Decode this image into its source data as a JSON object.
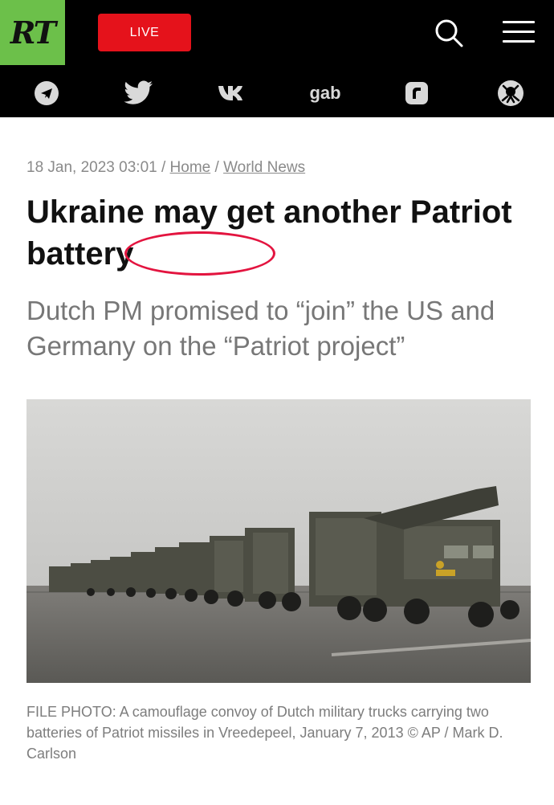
{
  "header": {
    "logo_text": "RT",
    "live_label": "LIVE",
    "social_icons": [
      "telegram-icon",
      "twitter-icon",
      "vk-icon",
      "gab-icon",
      "rumble-icon",
      "odysee-icon"
    ],
    "gab_label": "gab",
    "colors": {
      "logo": "#6cc04a",
      "live": "#e5121b",
      "bar": "#000000"
    }
  },
  "article": {
    "date": "18 Jan, 2023 03:01",
    "separator": "/",
    "breadcrumb": [
      "Home",
      "World News"
    ],
    "title": "Ukraine may get another Patriot battery",
    "subtitle": "Dutch PM promised to “join” the US and Germany on the “Patriot project”",
    "caption": "FILE PHOTO: A camouflage convoy of Dutch military trucks carrying two batteries of Patriot missiles in Vreedepeel, January 7, 2013 © AP / Mark D. Carlson",
    "highlight_color": "#e3143f"
  }
}
